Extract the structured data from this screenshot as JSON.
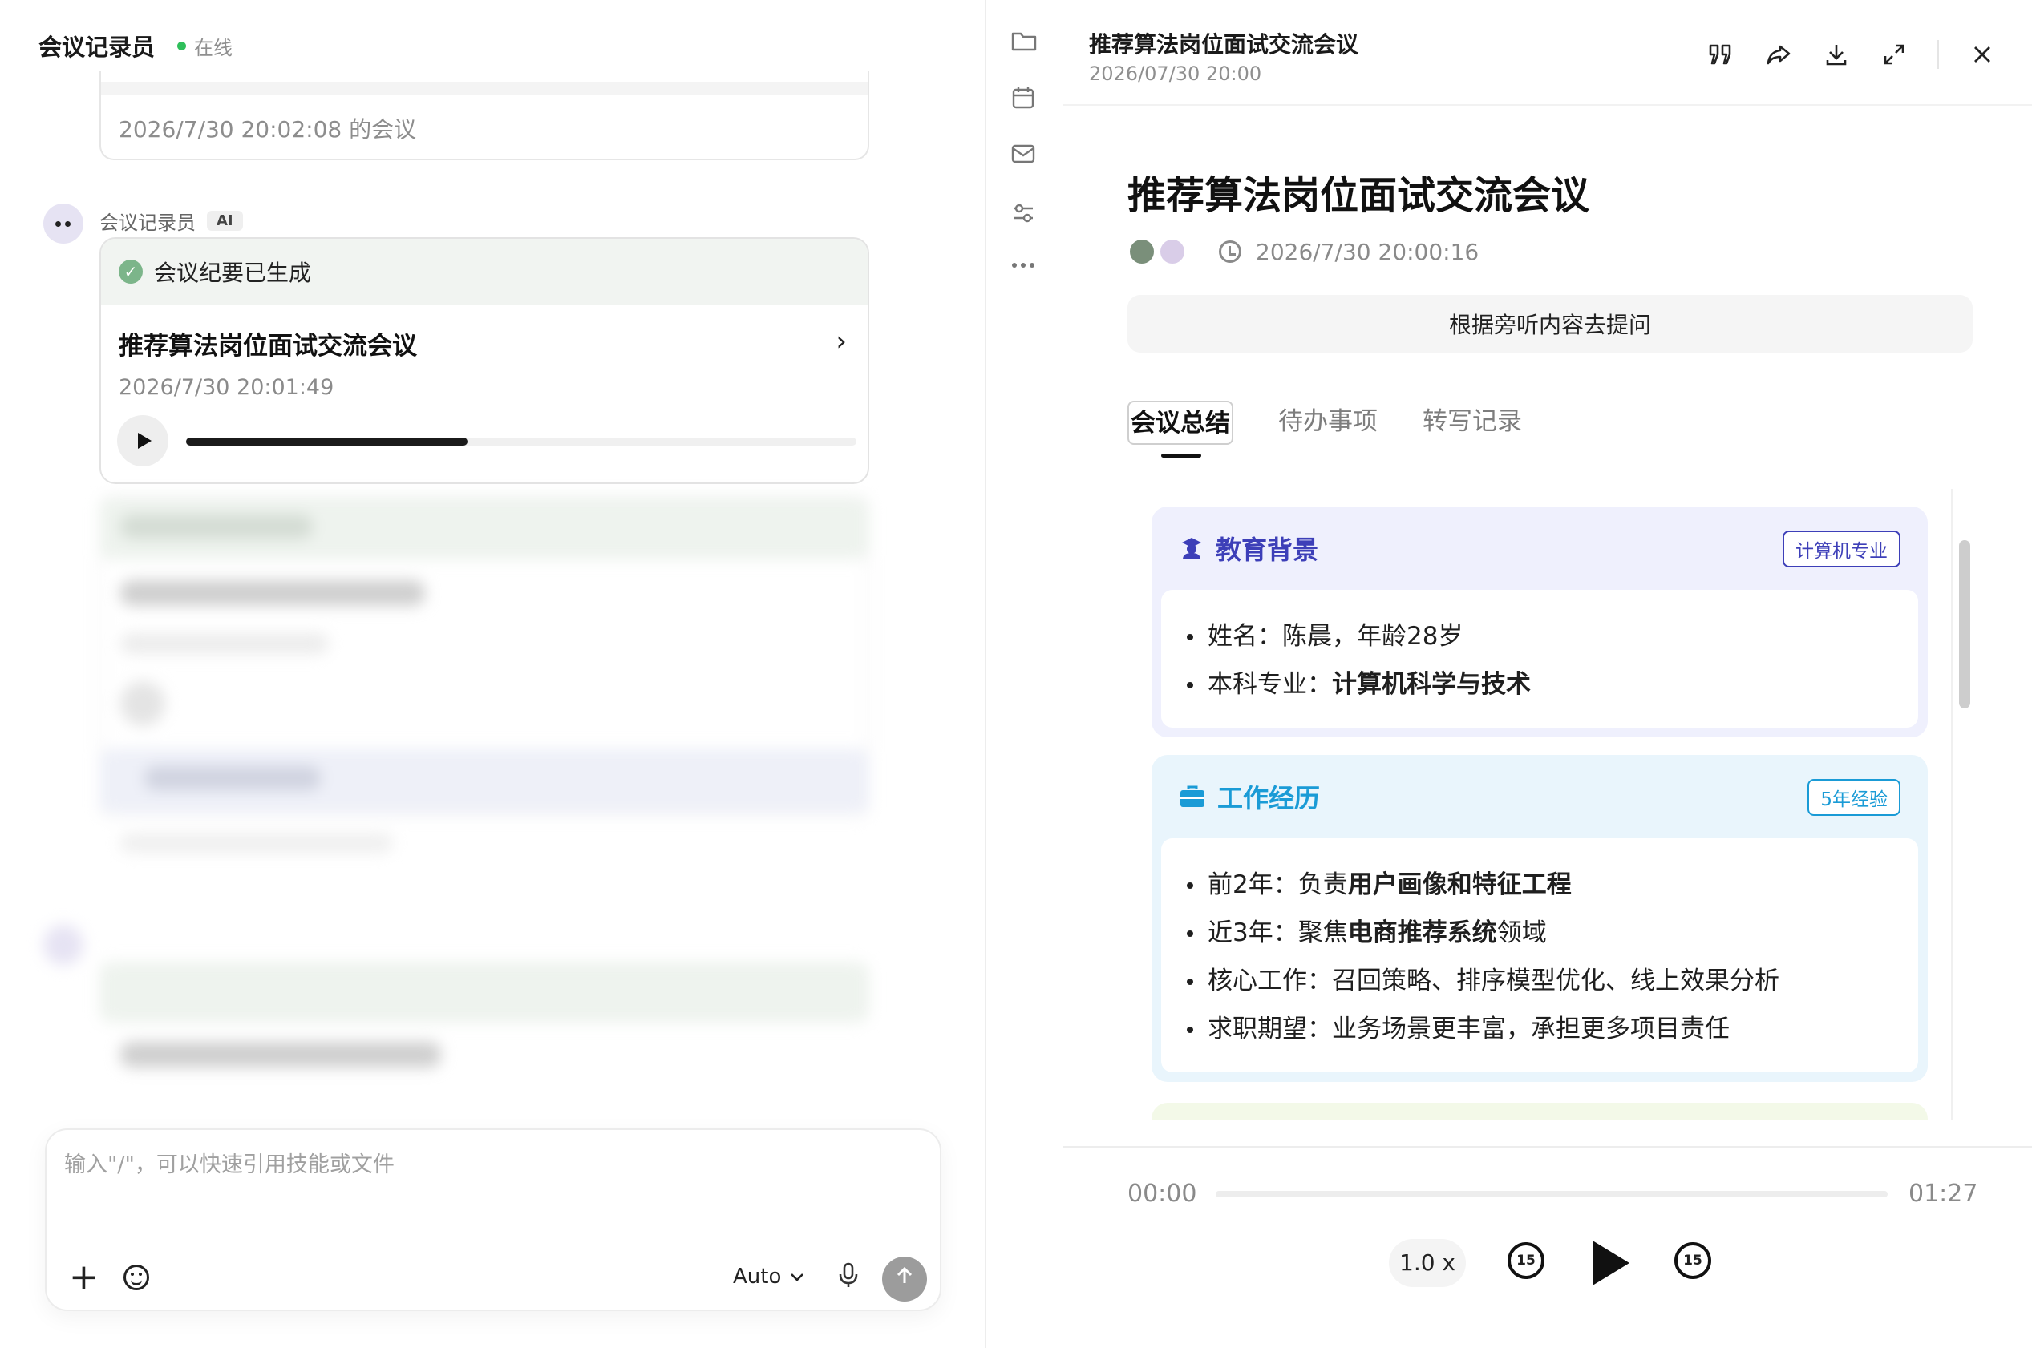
{
  "chat": {
    "title": "会议记录员",
    "status": "在线",
    "previous_meeting_label": "2026/7/30 20:02:08 的会议",
    "bot": {
      "name": "会议记录员",
      "badge": "AI"
    },
    "summary_card": {
      "status_text": "会议纪要已生成",
      "title": "推荐算法岗位面试交流会议",
      "time": "2026/7/30 20:01:49",
      "audio_progress": 0.42
    },
    "composer": {
      "placeholder": "输入\"/\"，可以快速引用技能或文件",
      "model": "Auto"
    }
  },
  "rail": {
    "icons": [
      "folder-icon",
      "calendar-icon",
      "mail-icon",
      "sliders-icon",
      "more-icon"
    ]
  },
  "detail": {
    "header": {
      "title": "推荐算法岗位面试交流会议",
      "subtitle": "2026/07/30 20:00"
    },
    "doc_title": "推荐算法岗位面试交流会议",
    "timestamp": "2026/7/30 20:00:16",
    "ask_button": "根据旁听内容去提问",
    "tabs": [
      {
        "label": "会议总结",
        "active": true
      },
      {
        "label": "待办事项",
        "active": false
      },
      {
        "label": "转写记录",
        "active": false
      }
    ],
    "sections": [
      {
        "title": "教育背景",
        "tag": "计算机专业",
        "accent": "#3d3fb8",
        "icon": "graduate-icon",
        "items": [
          {
            "label": "姓名：",
            "text": "陈晨，年龄28岁",
            "bold": "",
            "suffix": ""
          },
          {
            "label": "本科专业：",
            "text": "",
            "bold": "计算机科学与技术",
            "suffix": ""
          }
        ]
      },
      {
        "title": "工作经历",
        "tag": "5年经验",
        "accent": "#1a9bd6",
        "icon": "briefcase-icon",
        "items": [
          {
            "label": "前2年：",
            "text": "负责",
            "bold": "用户画像和特征工程",
            "suffix": ""
          },
          {
            "label": "近3年：",
            "text": "聚焦",
            "bold": "电商推荐系统",
            "suffix": "领域"
          },
          {
            "label": "核心工作：",
            "text": "召回策略、排序模型优化、线上效果分析",
            "bold": "",
            "suffix": ""
          },
          {
            "label": "求职期望：",
            "text": "业务场景更丰富，承担更多项目责任",
            "bold": "",
            "suffix": ""
          }
        ]
      }
    ],
    "player": {
      "current": "00:00",
      "duration": "01:27",
      "speed": "1.0 x",
      "skip_back": "15",
      "skip_forward": "15",
      "progress": 0
    }
  }
}
